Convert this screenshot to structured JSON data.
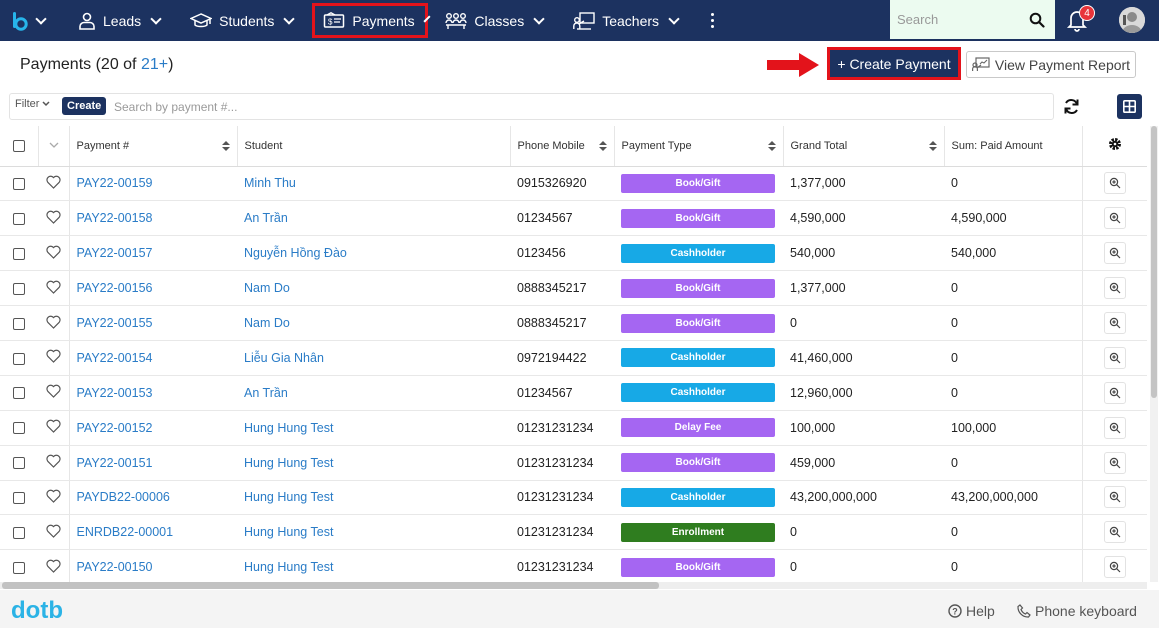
{
  "nav": {
    "items": [
      {
        "label": "Leads",
        "icon": "user-icon"
      },
      {
        "label": "Students",
        "icon": "graduation-cap-icon"
      },
      {
        "label": "Payments",
        "icon": "payment-ticket-icon"
      },
      {
        "label": "Classes",
        "icon": "classes-group-icon"
      },
      {
        "label": "Teachers",
        "icon": "teacher-board-icon"
      }
    ],
    "search_placeholder": "Search",
    "notification_count": "4"
  },
  "header": {
    "title_prefix": "Payments (20 of ",
    "title_link": "21+",
    "title_suffix": ")",
    "create_label": "+ Create Payment",
    "report_label": "View Payment Report"
  },
  "filter": {
    "filter_label": "Filter",
    "create_label": "Create",
    "search_placeholder": "Search by payment #..."
  },
  "columns": [
    "Payment #",
    "Student",
    "Phone Mobile",
    "Payment Type",
    "Grand Total",
    "Sum: Paid Amount"
  ],
  "rows": [
    {
      "payment": "PAY22-00159",
      "student": "Minh Thu",
      "phone": "0915326920",
      "type": "Book/Gift",
      "total": "1,377,000",
      "paid": "0"
    },
    {
      "payment": "PAY22-00158",
      "student": "An Trần",
      "phone": "01234567",
      "type": "Book/Gift",
      "total": "4,590,000",
      "paid": "4,590,000"
    },
    {
      "payment": "PAY22-00157",
      "student": "Nguyễn Hồng Đào",
      "phone": "0123456",
      "type": "Cashholder",
      "total": "540,000",
      "paid": "540,000"
    },
    {
      "payment": "PAY22-00156",
      "student": "Nam Do",
      "phone": "0888345217",
      "type": "Book/Gift",
      "total": "1,377,000",
      "paid": "0"
    },
    {
      "payment": "PAY22-00155",
      "student": "Nam Do",
      "phone": "0888345217",
      "type": "Book/Gift",
      "total": "0",
      "paid": "0"
    },
    {
      "payment": "PAY22-00154",
      "student": "Liễu Gia Nhân",
      "phone": "0972194422",
      "type": "Cashholder",
      "total": "41,460,000",
      "paid": "0"
    },
    {
      "payment": "PAY22-00153",
      "student": "An Trần",
      "phone": "01234567",
      "type": "Cashholder",
      "total": "12,960,000",
      "paid": "0"
    },
    {
      "payment": "PAY22-00152",
      "student": "Hung Hung Test",
      "phone": "01231231234",
      "type": "Delay Fee",
      "total": "100,000",
      "paid": "100,000"
    },
    {
      "payment": "PAY22-00151",
      "student": "Hung Hung Test",
      "phone": "01231231234",
      "type": "Book/Gift",
      "total": "459,000",
      "paid": "0"
    },
    {
      "payment": "PAYDB22-00006",
      "student": "Hung Hung Test",
      "phone": "01231231234",
      "type": "Cashholder",
      "total": "43,200,000,000",
      "paid": "43,200,000,000"
    },
    {
      "payment": "ENRDB22-00001",
      "student": "Hung Hung Test",
      "phone": "01231231234",
      "type": "Enrollment",
      "total": "0",
      "paid": "0"
    },
    {
      "payment": "PAY22-00150",
      "student": "Hung Hung Test",
      "phone": "01231231234",
      "type": "Book/Gift",
      "total": "0",
      "paid": "0"
    }
  ],
  "type_colors": {
    "Book/Gift": "#a566f2",
    "Cashholder": "#17a9e6",
    "Delay Fee": "#a566f2",
    "Enrollment": "#2f7d1f"
  },
  "footer": {
    "logo_text": "dotb",
    "help_label": "Help",
    "phone_label": "Phone keyboard"
  },
  "colors": {
    "brand_navy": "#1c3260",
    "link": "#2a7cc7",
    "highlight_red": "#e3131b"
  }
}
